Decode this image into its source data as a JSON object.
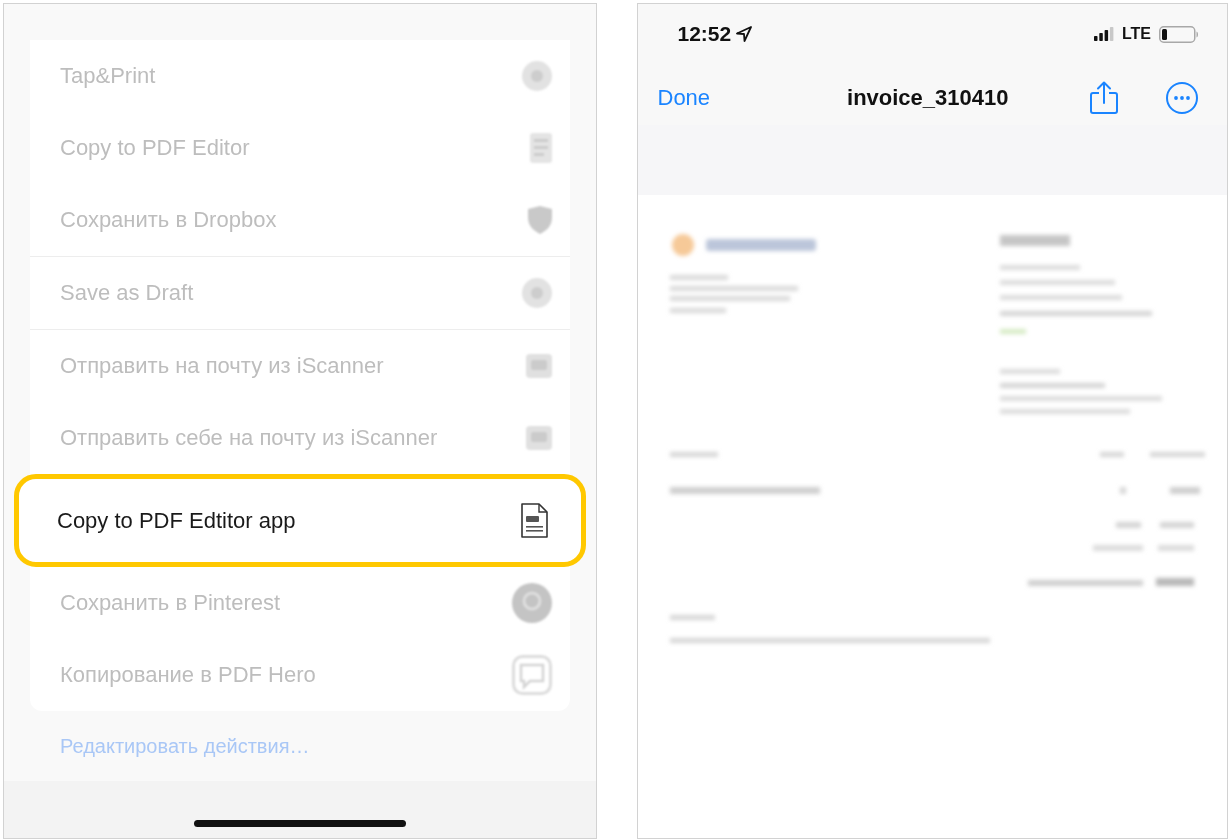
{
  "share_sheet": {
    "action_groups": [
      {
        "actions": [
          {
            "label": "Tap&Print",
            "highlighted": false
          },
          {
            "label": "Copy to PDF Editor",
            "highlighted": false
          },
          {
            "label": "Сохранить в Dropbox",
            "highlighted": false
          }
        ]
      },
      {
        "actions": [
          {
            "label": "Save as Draft",
            "highlighted": false
          }
        ]
      },
      {
        "actions": [
          {
            "label": "Отправить на почту из iScanner",
            "highlighted": false
          },
          {
            "label": "Отправить себе на почту из iScanner",
            "highlighted": false
          },
          {
            "label": "Copy to PDF Edtitor app",
            "highlighted": true
          },
          {
            "label": "Сохранить в Pinterest",
            "highlighted": false
          },
          {
            "label": "Копирование в PDF Hero",
            "highlighted": false
          }
        ]
      }
    ],
    "edit_actions_link": "Редактировать действия…"
  },
  "pdf_viewer": {
    "status_bar": {
      "time": "12:52",
      "network": "LTE"
    },
    "nav_bar": {
      "done_button": "Done",
      "title": "invoice_310410"
    }
  }
}
